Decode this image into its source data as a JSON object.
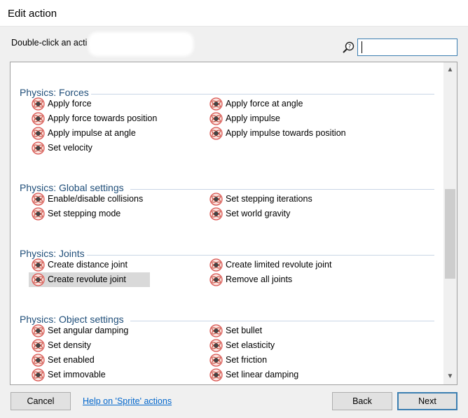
{
  "window": {
    "title": "Edit action"
  },
  "prompt": {
    "text": "Double-click an acti"
  },
  "search": {
    "value": "",
    "placeholder": ""
  },
  "groups": [
    {
      "title": "Physics: Forces",
      "items": [
        "Apply force",
        "Apply force at angle",
        "Apply force towards position",
        "Apply impulse",
        "Apply impulse at angle",
        "Apply impulse towards position",
        "Set velocity"
      ]
    },
    {
      "title": "Physics: Global settings",
      "items": [
        "Enable/disable collisions",
        "Set stepping iterations",
        "Set stepping mode",
        "Set world gravity"
      ]
    },
    {
      "title": "Physics: Joints",
      "items": [
        "Create distance joint",
        "Create limited revolute joint",
        "Create revolute joint",
        "Remove all joints"
      ]
    },
    {
      "title": "Physics: Object settings",
      "items": [
        "Set angular damping",
        "Set bullet",
        "Set density",
        "Set elasticity",
        "Set enabled",
        "Set friction",
        "Set immovable",
        "Set linear damping"
      ]
    }
  ],
  "selected_item": "Create revolute joint",
  "footer": {
    "cancel_label": "Cancel",
    "help_label": "Help on 'Sprite' actions",
    "back_label": "Back",
    "next_label": "Next"
  },
  "colors": {
    "group_title": "#1f4e79",
    "link": "#0066cc",
    "focus_border": "#3c7fb1",
    "icon_ring": "#d9534f"
  },
  "icons": {
    "action_icon": "physics-atom-icon",
    "search_icon": "magnifier-help-icon"
  }
}
